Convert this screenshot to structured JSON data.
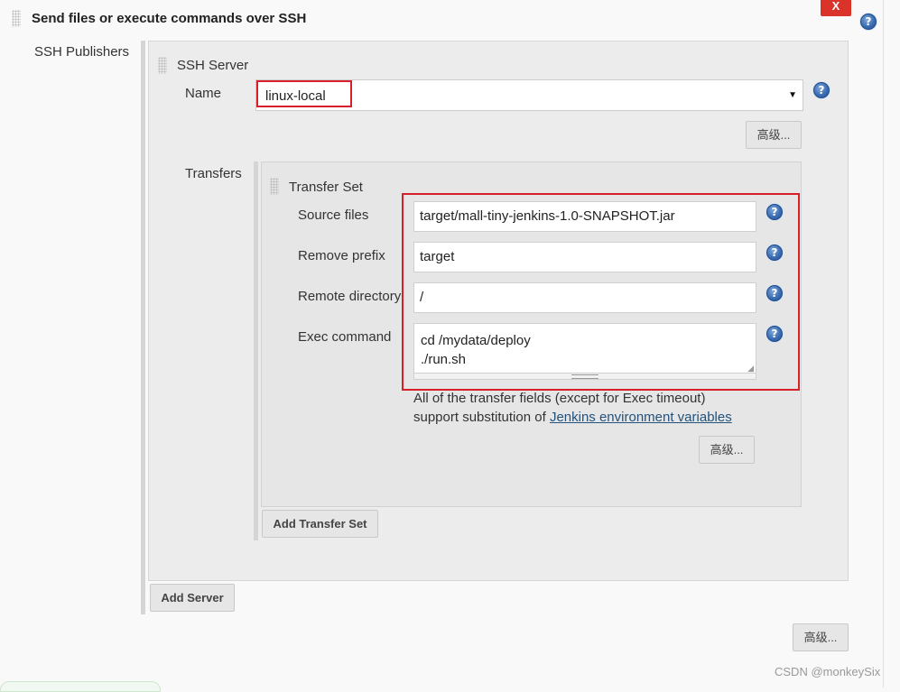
{
  "step": {
    "title": "Send files or execute commands over SSH",
    "delete_label": "X"
  },
  "publishers": {
    "label": "SSH Publishers",
    "server": {
      "section_title": "SSH Server",
      "name_label": "Name",
      "name_value": "linux-local",
      "advanced_label": "高级...",
      "transfers_label": "Transfers",
      "transfer_set": {
        "title": "Transfer Set",
        "source_files_label": "Source files",
        "source_files_value": "target/mall-tiny-jenkins-1.0-SNAPSHOT.jar",
        "remove_prefix_label": "Remove prefix",
        "remove_prefix_value": "target",
        "remote_directory_label": "Remote directory",
        "remote_directory_value": "/",
        "exec_command_label": "Exec command",
        "exec_command_line1": "cd /mydata/deploy",
        "exec_command_line2": "./run.sh",
        "note_line1": "All of the transfer fields (except for Exec timeout)",
        "note_prefix": "support substitution of ",
        "note_link": "Jenkins environment variables",
        "advanced_label": "高级..."
      },
      "add_transfer_set_label": "Add Transfer Set"
    },
    "add_server_label": "Add Server",
    "advanced_label": "高级..."
  },
  "watermark": "CSDN @monkeySix",
  "colors": {
    "highlight": "#d8202a",
    "link": "#23527c",
    "help": "#3c6eb4"
  }
}
